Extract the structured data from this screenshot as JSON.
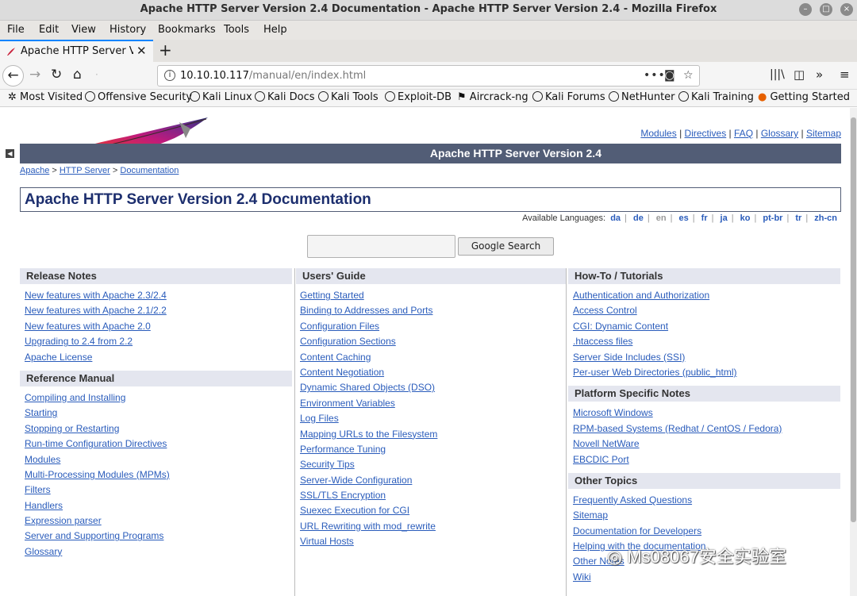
{
  "window": {
    "title": "Apache HTTP Server Version 2.4 Documentation - Apache HTTP Server Version 2.4 - Mozilla Firefox"
  },
  "menu": [
    "File",
    "Edit",
    "View",
    "History",
    "Bookmarks",
    "Tools",
    "Help"
  ],
  "tab": {
    "label": "Apache HTTP Server Ver",
    "new_tab": "+"
  },
  "url": {
    "host": "10.10.10.117",
    "path": "/manual/en/index.html"
  },
  "bookmarks": [
    "Most Visited",
    "Offensive Security",
    "Kali Linux",
    "Kali Docs",
    "Kali Tools",
    "Exploit-DB",
    "Aircrack-ng",
    "Kali Forums",
    "NetHunter",
    "Kali Training",
    "Getting Started"
  ],
  "page": {
    "top_links": [
      "Modules",
      "Directives",
      "FAQ",
      "Glossary",
      "Sitemap"
    ],
    "banner": "Apache HTTP Server Version 2.4",
    "breadcrumb": [
      "Apache",
      "HTTP Server",
      "Documentation"
    ],
    "heading": "Apache HTTP Server Version 2.4 Documentation",
    "languages_label": "Available Languages:",
    "languages": [
      "da",
      "de",
      "en",
      "es",
      "fr",
      "ja",
      "ko",
      "pt-br",
      "tr",
      "zh-cn"
    ],
    "current_language": "en",
    "search_button": "Google Search",
    "col1": [
      {
        "title": "Release Notes",
        "links": [
          "New features with Apache 2.3/2.4",
          "New features with Apache 2.1/2.2",
          "New features with Apache 2.0",
          "Upgrading to 2.4 from 2.2",
          "Apache License"
        ]
      },
      {
        "title": "Reference Manual",
        "links": [
          "Compiling and Installing",
          "Starting",
          "Stopping or Restarting",
          "Run-time Configuration Directives",
          "Modules",
          "Multi-Processing Modules (MPMs)",
          "Filters",
          "Handlers",
          "Expression parser",
          "Server and Supporting Programs",
          "Glossary"
        ]
      }
    ],
    "col2": [
      {
        "title": "Users' Guide",
        "links": [
          "Getting Started",
          "Binding to Addresses and Ports",
          "Configuration Files",
          "Configuration Sections",
          "Content Caching",
          "Content Negotiation",
          "Dynamic Shared Objects (DSO)",
          "Environment Variables",
          "Log Files",
          "Mapping URLs to the Filesystem",
          "Performance Tuning",
          "Security Tips",
          "Server-Wide Configuration",
          "SSL/TLS Encryption",
          "Suexec Execution for CGI",
          "URL Rewriting with mod_rewrite",
          "Virtual Hosts"
        ]
      }
    ],
    "col3": [
      {
        "title": "How-To / Tutorials",
        "links": [
          "Authentication and Authorization",
          "Access Control",
          "CGI: Dynamic Content",
          ".htaccess files",
          "Server Side Includes (SSI)",
          "Per-user Web Directories (public_html)"
        ]
      },
      {
        "title": "Platform Specific Notes",
        "links": [
          "Microsoft Windows",
          "RPM-based Systems (Redhat / CentOS / Fedora)",
          "Novell NetWare",
          "EBCDIC Port"
        ]
      },
      {
        "title": "Other Topics",
        "links": [
          "Frequently Asked Questions",
          "Sitemap",
          "Documentation for Developers",
          "Helping with the documentation",
          "Other Notes",
          "Wiki"
        ]
      }
    ]
  },
  "watermark": "Ms08067安全实验室",
  "colors": {
    "banner": "#525d76",
    "link": "#2a5cbb",
    "section_header": "#e4e6ef",
    "tab_accent": "#0a84ff"
  }
}
